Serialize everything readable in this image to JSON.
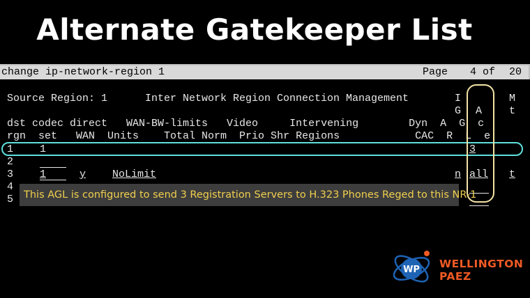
{
  "title": "Alternate Gatekeeper List",
  "header": {
    "command": "change ip-network-region 1",
    "page_label": "Page",
    "page_current": "4",
    "page_of": "of",
    "page_total": "20"
  },
  "form": {
    "source_region": "Source Region: 1",
    "section_title": "Inter Network Region Connection Management",
    "stacked_headers": {
      "iga_row1": "I",
      "iga_row2": "G",
      "agl_row1": "A",
      "agl_row2": "G",
      "mt_row1": "M",
      "mt_row2": "t"
    },
    "header_line1": "dst codec direct   WAN-BW-limits   Video     Intervening        Dyn  A  G  c",
    "header_line2": "rgn  set   WAN  Units    Total Norm  Prio Shr Regions            CAC  R  L  e",
    "rows": [
      {
        "rgn": "1",
        "codec": "1",
        "agl": "3"
      },
      {
        "rgn": "2"
      },
      {
        "rgn": "3",
        "codec": "1",
        "wan": "y",
        "units": "NoLimit",
        "iga": "n",
        "agl": "all",
        "mt": "t"
      },
      {
        "rgn": "4"
      },
      {
        "rgn": "5"
      }
    ]
  },
  "tooltip": "This AGL is configured to send 3 Registration Servers to H.323 Phones Reged to this NR-1",
  "brand": {
    "logo_text": "WP",
    "line1": "WELLINGTON",
    "line2": "PAEZ",
    "accent": "#f05a24",
    "logo_blue": "#1e63b4"
  }
}
